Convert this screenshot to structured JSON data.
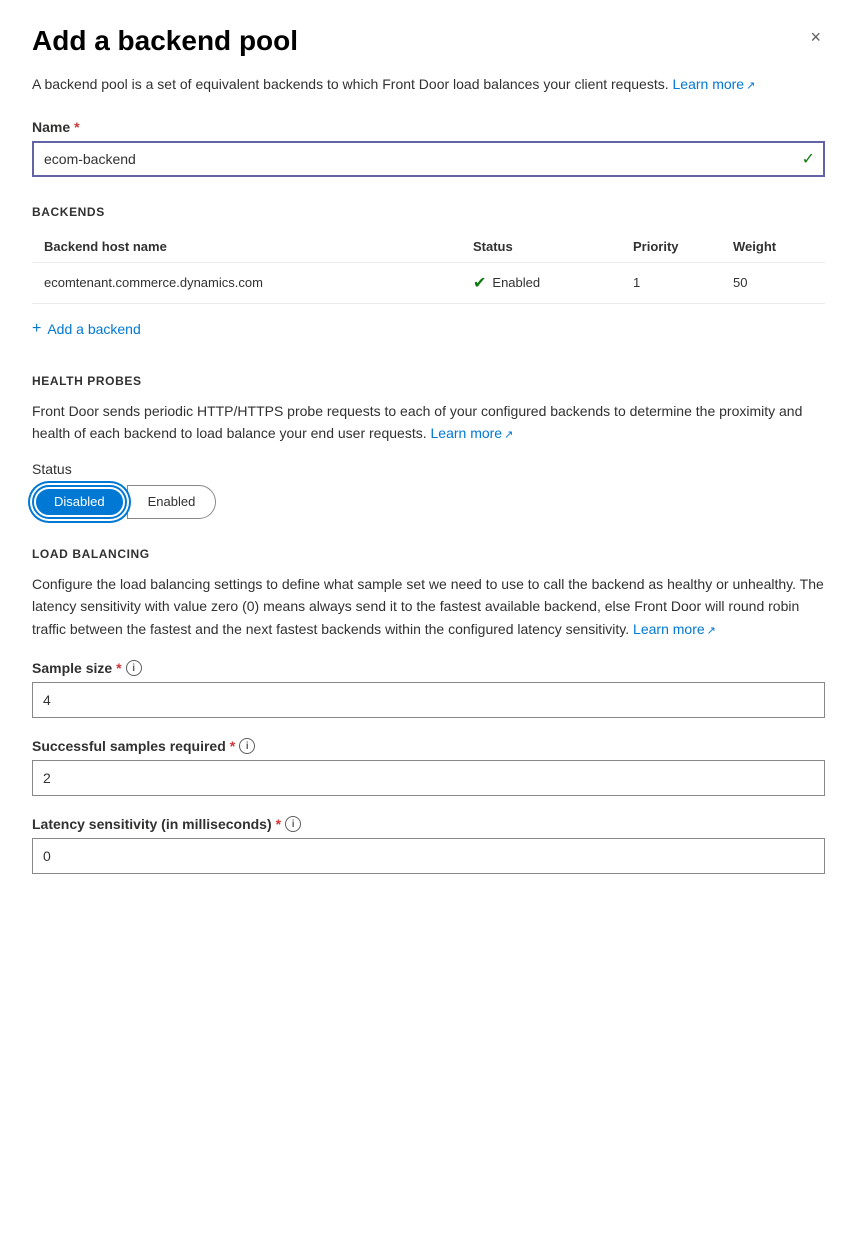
{
  "panel": {
    "title": "Add a backend pool",
    "close_label": "×",
    "description": "A backend pool is a set of equivalent backends to which Front Door load balances your client requests.",
    "learn_more_link": "Learn more",
    "learn_more_external_icon": "↗"
  },
  "name_field": {
    "label": "Name",
    "required": true,
    "value": "ecom-backend",
    "placeholder": ""
  },
  "backends_section": {
    "header": "BACKENDS",
    "columns": {
      "host": "Backend host name",
      "status": "Status",
      "priority": "Priority",
      "weight": "Weight"
    },
    "rows": [
      {
        "host": "ecomtenant.commerce.dynamics.com",
        "status": "Enabled",
        "priority": "1",
        "weight": "50"
      }
    ],
    "add_label": "Add a backend"
  },
  "health_probes_section": {
    "header": "HEALTH PROBES",
    "description": "Front Door sends periodic HTTP/HTTPS probe requests to each of your configured backends to determine the proximity and health of each backend to load balance your end user requests.",
    "learn_more_link": "Learn more",
    "learn_more_external_icon": "↗",
    "status_label": "Status",
    "toggle_options": [
      {
        "label": "Disabled",
        "active": true
      },
      {
        "label": "Enabled",
        "active": false
      }
    ]
  },
  "load_balancing_section": {
    "header": "LOAD BALANCING",
    "description": "Configure the load balancing settings to define what sample set we need to use to call the backend as healthy or unhealthy. The latency sensitivity with value zero (0) means always send it to the fastest available backend, else Front Door will round robin traffic between the fastest and the next fastest backends within the configured latency sensitivity.",
    "learn_more_link": "Learn more",
    "learn_more_external_icon": "↗",
    "sample_size_label": "Sample size",
    "sample_size_value": "4",
    "successful_samples_label": "Successful samples required",
    "successful_samples_value": "2",
    "latency_label": "Latency sensitivity (in milliseconds)",
    "latency_value": "0"
  },
  "icons": {
    "check": "✓",
    "circle_check": "✔",
    "plus": "+",
    "external_link": "⧉",
    "info": "i"
  },
  "colors": {
    "blue": "#0078d4",
    "green": "#107c10",
    "required": "#d13438"
  }
}
